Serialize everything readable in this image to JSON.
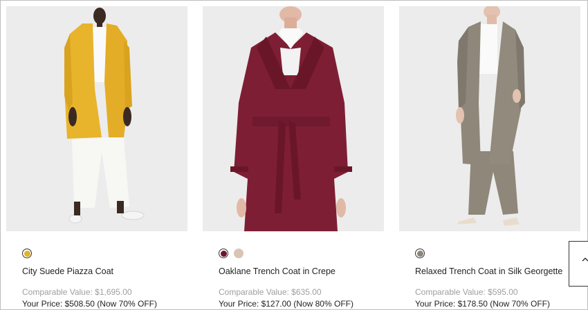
{
  "products": [
    {
      "name": "City Suede Piazza Coat",
      "comparable": "Comparable Value: $1,695.00",
      "price": "Your Price: $508.50 (Now 70% OFF)",
      "swatches": [
        "#e3b324"
      ],
      "coat_color": "#e8b42c",
      "image_icon": "model-in-yellow-coat-photo"
    },
    {
      "name": "Oaklane Trench Coat in Crepe",
      "comparable": "Comparable Value: $635.00",
      "price": "Your Price: $127.00 (Now 80% OFF)",
      "swatches": [
        "#6d1530",
        "#d9c4b6"
      ],
      "coat_color": "#7e1e34",
      "image_icon": "model-in-burgundy-trench-photo"
    },
    {
      "name": "Relaxed Trench Coat in Silk Georgette",
      "comparable": "Comparable Value: $595.00",
      "price": "Your Price: $178.50 (Now 70% OFF)",
      "swatches": [
        "#8c8579"
      ],
      "coat_color": "#8f877a",
      "image_icon": "model-in-taupe-trench-photo"
    }
  ],
  "back_to_top_icon": "chevron-up-icon"
}
